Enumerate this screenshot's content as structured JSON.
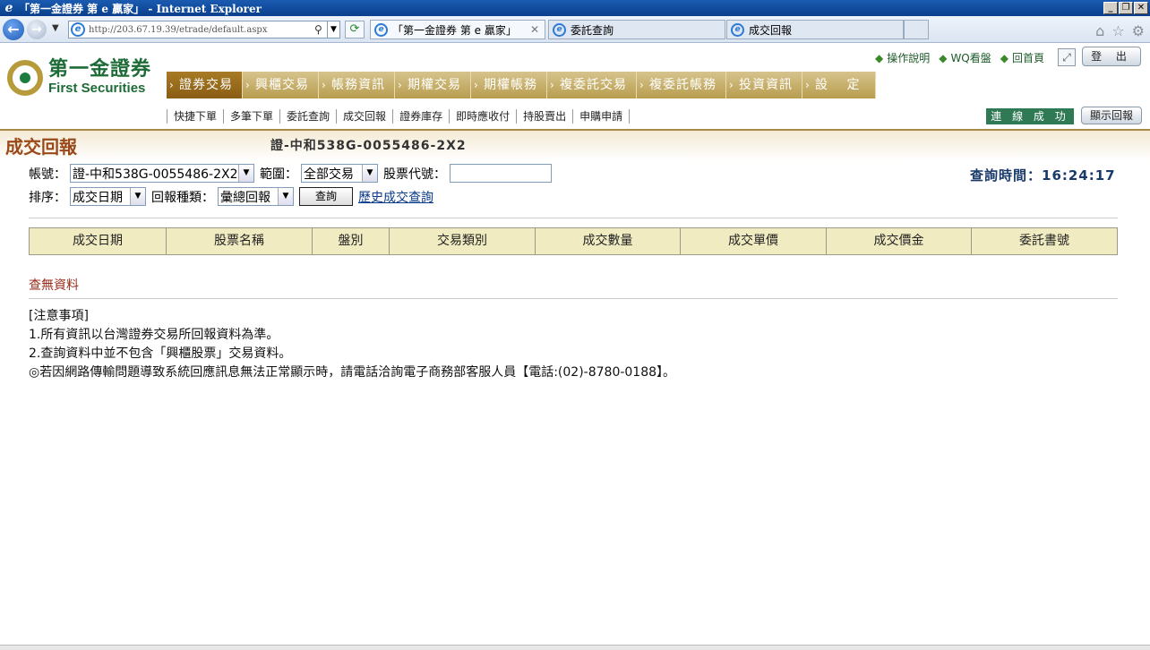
{
  "window": {
    "title": "「第一金證券 第 e 贏家」 - Internet Explorer",
    "minimize": "_",
    "restore": "❐",
    "close": "✕"
  },
  "browser": {
    "url": "http://203.67.19.39/etrade/default.aspx",
    "tabs": [
      {
        "label": "「第一金證券 第 e 贏家」",
        "active": true
      },
      {
        "label": "委託查詢",
        "active": false
      },
      {
        "label": "成交回報",
        "active": false
      }
    ],
    "icons": [
      "home-icon",
      "star-icon",
      "gear-icon"
    ]
  },
  "logo": {
    "cn": "第一金證券",
    "en": "First Securities"
  },
  "main_nav": [
    {
      "label": "證券交易",
      "active": true
    },
    {
      "label": "興櫃交易",
      "active": false
    },
    {
      "label": "帳務資訊",
      "active": false
    },
    {
      "label": "期權交易",
      "active": false
    },
    {
      "label": "期權帳務",
      "active": false
    },
    {
      "label": "複委託交易",
      "active": false
    },
    {
      "label": "複委託帳務",
      "active": false
    },
    {
      "label": "投資資訊",
      "active": false
    },
    {
      "label": "設　 定",
      "active": false
    }
  ],
  "top_links": [
    "操作說明",
    "WQ看盤",
    "回首頁"
  ],
  "logout_label": "登 出",
  "sub_nav": [
    "快捷下單",
    "多筆下單",
    "委託查詢",
    "成交回報",
    "證券庫存",
    "即時應收付",
    "持股賣出",
    "申購申請"
  ],
  "status": "連 線 成 功",
  "show_report_label": "顯示回報",
  "page": {
    "title": "成交回報",
    "account_title": "證-中和538G-0055486-2X2"
  },
  "form": {
    "account_label": "帳號：",
    "account_value": "證-中和538G-0055486-2X2",
    "range_label": "範圍：",
    "range_value": "全部交易",
    "stock_code_label": "股票代號：",
    "stock_code_value": "",
    "sort_label": "排序：",
    "sort_value": "成交日期",
    "report_type_label": "回報種類：",
    "report_type_value": "彙總回報",
    "query_label": "查詢",
    "history_link": "歷史成交查詢",
    "query_time": "查詢時間：16:24:17"
  },
  "table": {
    "headers": [
      "成交日期",
      "股票名稱",
      "盤別",
      "交易類別",
      "成交數量",
      "成交單價",
      "成交價金",
      "委託書號"
    ]
  },
  "no_data": "查無資料",
  "notes": [
    "[注意事項]",
    "1.所有資訊以台灣證券交易所回報資料為準。",
    "2.查詢資料中並不包含「興櫃股票」交易資料。",
    "◎若因網路傳輸問題導致系統回應訊息無法正常顯示時，請電話洽詢電子商務部客服人員【電話:(02)-8780-0188】。"
  ]
}
